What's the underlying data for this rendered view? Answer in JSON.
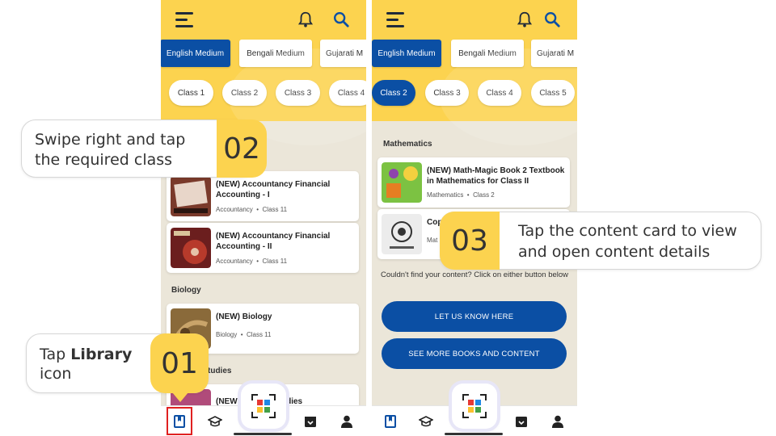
{
  "colors": {
    "accent_yellow": "#fcd34f",
    "brand_blue": "#0b4fa4",
    "background": "#ebe6d9",
    "highlight_red": "#e02020"
  },
  "left_phone": {
    "mediums": [
      "English Medium",
      "Bengali Medium",
      "Gujarati M"
    ],
    "classes": [
      "Class 1",
      "Class 2",
      "Class 3",
      "Class 4"
    ],
    "sections": [
      {
        "label": "",
        "cards": [
          {
            "title": "(NEW) Accountancy Financial Accounting - I",
            "subject": "Accountancy",
            "class": "Class 11"
          },
          {
            "title": "(NEW) Accountancy Financial Accounting - II",
            "subject": "Accountancy",
            "class": "Class 11"
          }
        ]
      },
      {
        "label": "Biology",
        "cards": [
          {
            "title": "(NEW) Biology",
            "subject": "Biology",
            "class": "Class 11"
          }
        ]
      }
    ],
    "partial_label": "tudies",
    "partial_card_title": "(NEW",
    "partial_card_title_end": "udies"
  },
  "right_phone": {
    "mediums": [
      "English Medium",
      "Bengali Medium",
      "Gujarati M"
    ],
    "classes": [
      "Class 2",
      "Class 3",
      "Class 4",
      "Class 5"
    ],
    "section_label": "Mathematics",
    "cards": [
      {
        "title": "(NEW) Math-Magic Book 2 Textbook in Mathematics for Class II",
        "subject": "Mathematics",
        "class": "Class 2"
      },
      {
        "title": "Cop",
        "subject": "Mat"
      }
    ],
    "help_text": "Couldn't find your content? Click on either button below",
    "btn_let_us_know": "LET US KNOW HERE",
    "btn_see_more": "SEE MORE BOOKS AND CONTENT"
  },
  "callouts": {
    "one": {
      "number": "01",
      "text_prefix": "Tap ",
      "text_bold": "Library",
      "text_suffix": "icon"
    },
    "two": {
      "number": "02",
      "line1": "Swipe right and tap",
      "line2": "the required class"
    },
    "three": {
      "number": "03",
      "line1": "Tap the content card to view",
      "line2": "and open content details"
    }
  },
  "icons": [
    "hamburger-icon",
    "bell-icon",
    "search-icon",
    "library-icon",
    "courses-icon",
    "qr-scan-icon",
    "downloads-icon",
    "profile-icon"
  ]
}
